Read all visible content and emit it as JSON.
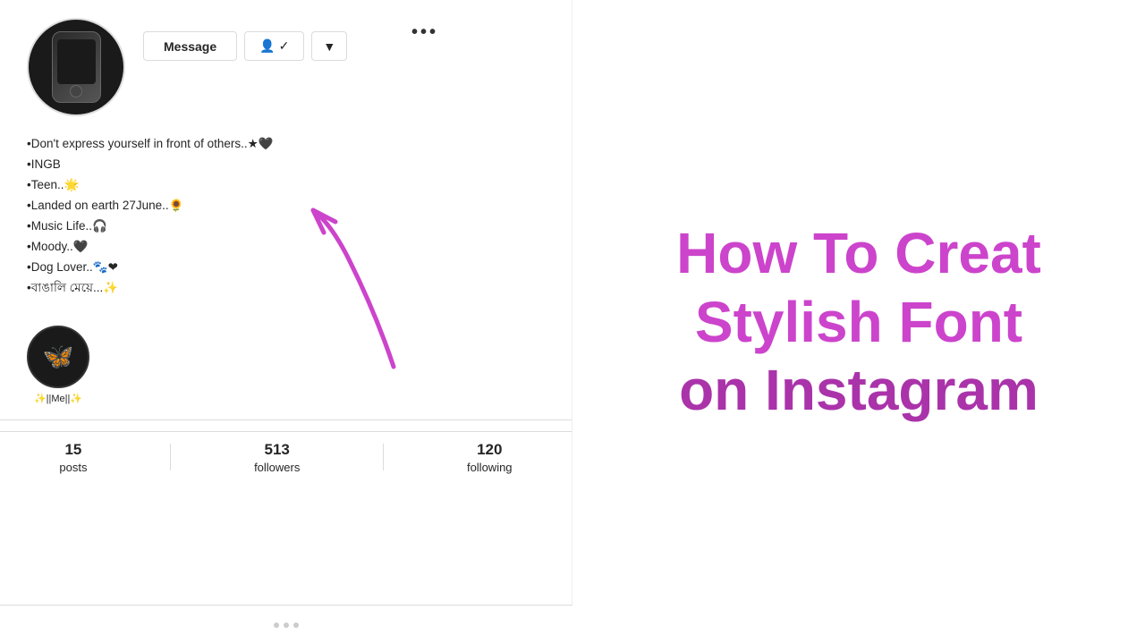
{
  "profile": {
    "more_dots": "...",
    "buttons": {
      "message": "Message",
      "follow_check": "✓",
      "dropdown": "▼"
    },
    "bio": [
      "•Don't express yourself in front of others..★🖤",
      "•INGB",
      "•Teen..🌟",
      "•Landed on earth 27June..🌻",
      "•Music Life..🎧",
      "•Moody..🖤",
      "•Dog Lover..🐾❤",
      "•বাঙালি মেয়ে...✨"
    ],
    "highlight_label": "✨||Me||✨",
    "stats": {
      "posts_count": "15",
      "posts_label": "posts",
      "followers_count": "513",
      "followers_label": "followers",
      "following_count": "120",
      "following_label": "following"
    }
  },
  "title": {
    "line1": "How To Creat Stylish Font",
    "line2": "on Instagram"
  },
  "icons": {
    "butterfly": "🦋",
    "more": "•••"
  }
}
